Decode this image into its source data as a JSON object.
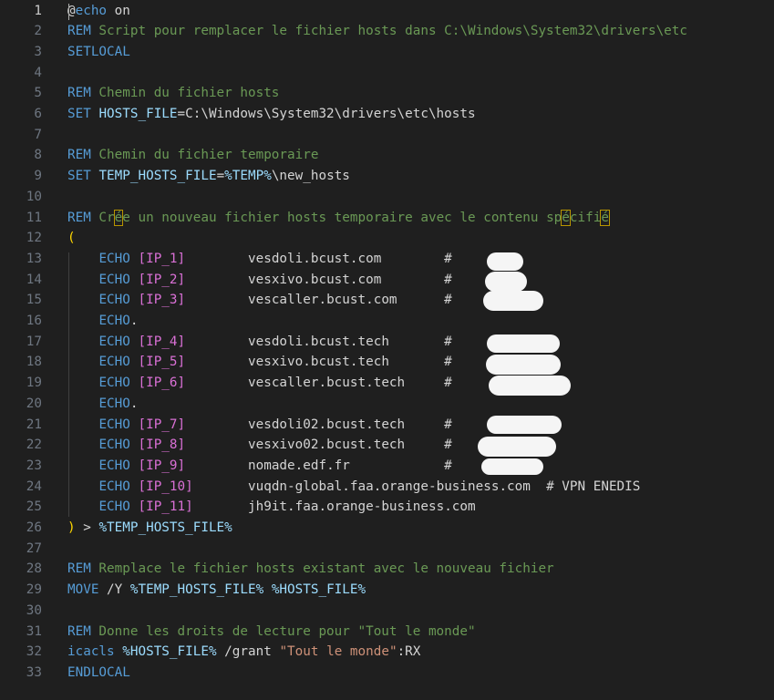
{
  "editor": {
    "lines": [
      {
        "num": "1",
        "tokens": [
          {
            "t": "@",
            "c": "t-text"
          },
          {
            "t": "echo",
            "c": "t-kw"
          },
          {
            "t": " on",
            "c": "t-text"
          }
        ]
      },
      {
        "num": "2",
        "tokens": [
          {
            "t": "REM",
            "c": "t-kw"
          },
          {
            "t": " Script pour remplacer le fichier hosts dans C:\\Windows\\System32\\drivers\\etc",
            "c": "t-com"
          }
        ]
      },
      {
        "num": "3",
        "tokens": [
          {
            "t": "SETLOCAL",
            "c": "t-kw"
          }
        ]
      },
      {
        "num": "4",
        "tokens": []
      },
      {
        "num": "5",
        "tokens": [
          {
            "t": "REM",
            "c": "t-kw"
          },
          {
            "t": " Chemin du fichier hosts",
            "c": "t-com"
          }
        ]
      },
      {
        "num": "6",
        "tokens": [
          {
            "t": "SET",
            "c": "t-kw"
          },
          {
            "t": " ",
            "c": "t-text"
          },
          {
            "t": "HOSTS_FILE",
            "c": "t-var"
          },
          {
            "t": "=C:\\Windows\\System32\\drivers\\etc\\hosts",
            "c": "t-text"
          }
        ]
      },
      {
        "num": "7",
        "tokens": []
      },
      {
        "num": "8",
        "tokens": [
          {
            "t": "REM",
            "c": "t-kw"
          },
          {
            "t": " Chemin du fichier temporaire",
            "c": "t-com"
          }
        ]
      },
      {
        "num": "9",
        "tokens": [
          {
            "t": "SET",
            "c": "t-kw"
          },
          {
            "t": " ",
            "c": "t-text"
          },
          {
            "t": "TEMP_HOSTS_FILE",
            "c": "t-var"
          },
          {
            "t": "=",
            "c": "t-text"
          },
          {
            "t": "%TEMP%",
            "c": "t-var"
          },
          {
            "t": "\\new_hosts",
            "c": "t-text"
          }
        ]
      },
      {
        "num": "10",
        "tokens": []
      },
      {
        "num": "11",
        "tokens": [
          {
            "t": "REM",
            "c": "t-kw"
          },
          {
            "t": " Cr",
            "c": "t-com"
          },
          {
            "t": "é",
            "c": "t-com bracket-box"
          },
          {
            "t": "e un nouveau fichier hosts temporaire avec le contenu sp",
            "c": "t-com"
          },
          {
            "t": "é",
            "c": "t-com bracket-box"
          },
          {
            "t": "cifi",
            "c": "t-com"
          },
          {
            "t": "é",
            "c": "t-com bracket-box"
          }
        ]
      },
      {
        "num": "12",
        "tokens": [
          {
            "t": "(",
            "c": "t-paren"
          }
        ]
      },
      {
        "num": "13",
        "tokens": [
          {
            "t": "    ",
            "c": "t-text"
          },
          {
            "t": "ECHO",
            "c": "t-kw"
          },
          {
            "t": " ",
            "c": "t-text"
          },
          {
            "t": "[IP_1]",
            "c": "t-bracket"
          },
          {
            "t": "        vesdoli.bcust.com        #",
            "c": "t-text"
          }
        ]
      },
      {
        "num": "14",
        "tokens": [
          {
            "t": "    ",
            "c": "t-text"
          },
          {
            "t": "ECHO",
            "c": "t-kw"
          },
          {
            "t": " ",
            "c": "t-text"
          },
          {
            "t": "[IP_2]",
            "c": "t-bracket"
          },
          {
            "t": "        vesxivo.bcust.com        #",
            "c": "t-text"
          }
        ]
      },
      {
        "num": "15",
        "tokens": [
          {
            "t": "    ",
            "c": "t-text"
          },
          {
            "t": "ECHO",
            "c": "t-kw"
          },
          {
            "t": " ",
            "c": "t-text"
          },
          {
            "t": "[IP_3]",
            "c": "t-bracket"
          },
          {
            "t": "        vescaller.bcust.com      #",
            "c": "t-text"
          }
        ]
      },
      {
        "num": "16",
        "tokens": [
          {
            "t": "    ",
            "c": "t-text"
          },
          {
            "t": "ECHO",
            "c": "t-kw"
          },
          {
            "t": ".",
            "c": "t-text"
          }
        ]
      },
      {
        "num": "17",
        "tokens": [
          {
            "t": "    ",
            "c": "t-text"
          },
          {
            "t": "ECHO",
            "c": "t-kw"
          },
          {
            "t": " ",
            "c": "t-text"
          },
          {
            "t": "[IP_4]",
            "c": "t-bracket"
          },
          {
            "t": "        vesdoli.bcust.tech       #",
            "c": "t-text"
          }
        ]
      },
      {
        "num": "18",
        "tokens": [
          {
            "t": "    ",
            "c": "t-text"
          },
          {
            "t": "ECHO",
            "c": "t-kw"
          },
          {
            "t": " ",
            "c": "t-text"
          },
          {
            "t": "[IP_5]",
            "c": "t-bracket"
          },
          {
            "t": "        vesxivo.bcust.tech       #",
            "c": "t-text"
          }
        ]
      },
      {
        "num": "19",
        "tokens": [
          {
            "t": "    ",
            "c": "t-text"
          },
          {
            "t": "ECHO",
            "c": "t-kw"
          },
          {
            "t": " ",
            "c": "t-text"
          },
          {
            "t": "[IP_6]",
            "c": "t-bracket"
          },
          {
            "t": "        vescaller.bcust.tech     #",
            "c": "t-text"
          }
        ]
      },
      {
        "num": "20",
        "tokens": [
          {
            "t": "    ",
            "c": "t-text"
          },
          {
            "t": "ECHO",
            "c": "t-kw"
          },
          {
            "t": ".",
            "c": "t-text"
          }
        ]
      },
      {
        "num": "21",
        "tokens": [
          {
            "t": "    ",
            "c": "t-text"
          },
          {
            "t": "ECHO",
            "c": "t-kw"
          },
          {
            "t": " ",
            "c": "t-text"
          },
          {
            "t": "[IP_7]",
            "c": "t-bracket"
          },
          {
            "t": "        vesdoli02.bcust.tech     #",
            "c": "t-text"
          }
        ]
      },
      {
        "num": "22",
        "tokens": [
          {
            "t": "    ",
            "c": "t-text"
          },
          {
            "t": "ECHO",
            "c": "t-kw"
          },
          {
            "t": " ",
            "c": "t-text"
          },
          {
            "t": "[IP_8]",
            "c": "t-bracket"
          },
          {
            "t": "        vesxivo02.bcust.tech     #",
            "c": "t-text"
          }
        ]
      },
      {
        "num": "23",
        "tokens": [
          {
            "t": "    ",
            "c": "t-text"
          },
          {
            "t": "ECHO",
            "c": "t-kw"
          },
          {
            "t": " ",
            "c": "t-text"
          },
          {
            "t": "[IP_9]",
            "c": "t-bracket"
          },
          {
            "t": "        nomade.edf.fr            #",
            "c": "t-text"
          }
        ]
      },
      {
        "num": "24",
        "tokens": [
          {
            "t": "    ",
            "c": "t-text"
          },
          {
            "t": "ECHO",
            "c": "t-kw"
          },
          {
            "t": " ",
            "c": "t-text"
          },
          {
            "t": "[IP_10]",
            "c": "t-bracket"
          },
          {
            "t": "       vuqdn-global.faa.orange-business.com  # VPN ENEDIS",
            "c": "t-text"
          }
        ]
      },
      {
        "num": "25",
        "tokens": [
          {
            "t": "    ",
            "c": "t-text"
          },
          {
            "t": "ECHO",
            "c": "t-kw"
          },
          {
            "t": " ",
            "c": "t-text"
          },
          {
            "t": "[IP_11]",
            "c": "t-bracket"
          },
          {
            "t": "       jh9it.faa.orange-business.com",
            "c": "t-text"
          }
        ]
      },
      {
        "num": "26",
        "tokens": [
          {
            "t": ")",
            "c": "t-paren"
          },
          {
            "t": " > ",
            "c": "t-text"
          },
          {
            "t": "%TEMP_HOSTS_FILE%",
            "c": "t-var"
          }
        ]
      },
      {
        "num": "27",
        "tokens": []
      },
      {
        "num": "28",
        "tokens": [
          {
            "t": "REM",
            "c": "t-kw"
          },
          {
            "t": " Remplace le fichier hosts existant avec le nouveau fichier",
            "c": "t-com"
          }
        ]
      },
      {
        "num": "29",
        "tokens": [
          {
            "t": "MOVE",
            "c": "t-kw"
          },
          {
            "t": " /Y ",
            "c": "t-text"
          },
          {
            "t": "%TEMP_HOSTS_FILE%",
            "c": "t-var"
          },
          {
            "t": " ",
            "c": "t-text"
          },
          {
            "t": "%HOSTS_FILE%",
            "c": "t-var"
          }
        ]
      },
      {
        "num": "30",
        "tokens": []
      },
      {
        "num": "31",
        "tokens": [
          {
            "t": "REM",
            "c": "t-kw"
          },
          {
            "t": " Donne les droits de lecture pour \"Tout le monde\"",
            "c": "t-com"
          }
        ]
      },
      {
        "num": "32",
        "tokens": [
          {
            "t": "icacls",
            "c": "t-kw"
          },
          {
            "t": " ",
            "c": "t-text"
          },
          {
            "t": "%HOSTS_FILE%",
            "c": "t-var"
          },
          {
            "t": " /grant ",
            "c": "t-text"
          },
          {
            "t": "\"Tout le monde\"",
            "c": "t-str"
          },
          {
            "t": ":RX",
            "c": "t-text"
          }
        ]
      },
      {
        "num": "33",
        "tokens": [
          {
            "t": "ENDLOCAL",
            "c": "t-kw"
          }
        ]
      }
    ],
    "active_line": "1"
  },
  "colors": {
    "background": "#1f1f1f",
    "keyword": "#569cd6",
    "comment": "#6a9955",
    "variable": "#9cdcfe",
    "bracket": "#da70d6",
    "paren": "#ffd700",
    "string": "#ce9178",
    "line_number": "#6e7681",
    "redaction": "#f5f5f5"
  }
}
